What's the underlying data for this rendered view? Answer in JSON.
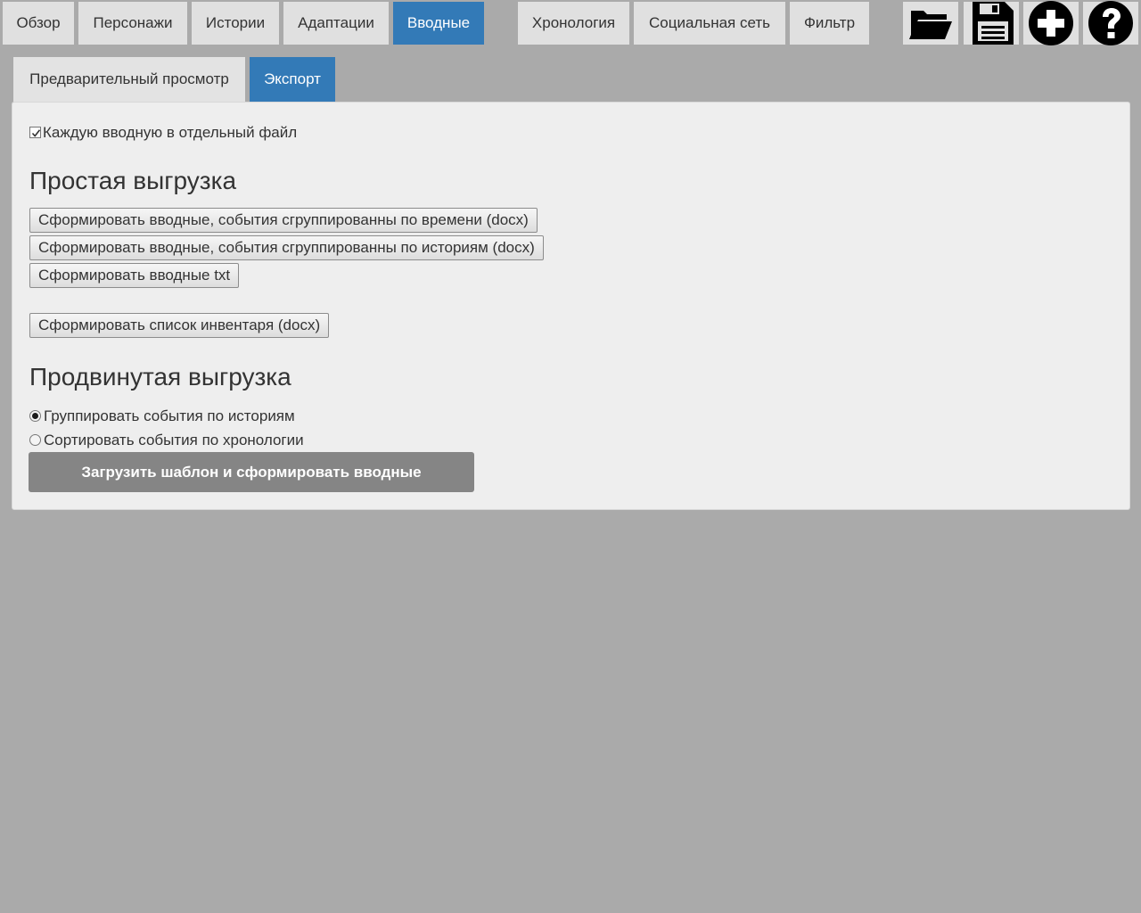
{
  "nav": {
    "tabs": [
      {
        "label": "Обзор"
      },
      {
        "label": "Персонажи"
      },
      {
        "label": "Истории"
      },
      {
        "label": "Адаптации"
      },
      {
        "label": "Вводные",
        "active": true
      },
      {
        "label": "Хронология"
      },
      {
        "label": "Социальная сеть"
      },
      {
        "label": "Фильтр"
      }
    ],
    "icons": [
      "folder-open-icon",
      "floppy-disk-icon",
      "plus-circle-icon",
      "question-circle-icon"
    ]
  },
  "subtabs": [
    {
      "label": "Предварительный просмотр"
    },
    {
      "label": "Экспорт",
      "active": true
    }
  ],
  "export": {
    "separate_files": {
      "label": "Каждую вводную в отдельный файл",
      "checked": true
    },
    "simple": {
      "title": "Простая выгрузка",
      "buttons": [
        "Сформировать вводные, события сгруппированны по времени (docx)",
        "Сформировать вводные, события сгруппированны по историям (docx)",
        "Сформировать вводные txt",
        "Сформировать список инвентаря (docx)"
      ]
    },
    "advanced": {
      "title": "Продвинутая выгрузка",
      "options": [
        {
          "label": "Группировать события по историям",
          "checked": true
        },
        {
          "label": "Сортировать события по хронологии",
          "checked": false
        }
      ],
      "generate_button": "Загрузить шаблон и сформировать вводные"
    }
  },
  "colors": {
    "accent": "#337ab7",
    "background": "#aaaaaa",
    "panel": "#eeeeee",
    "primary_button": "#858585"
  }
}
